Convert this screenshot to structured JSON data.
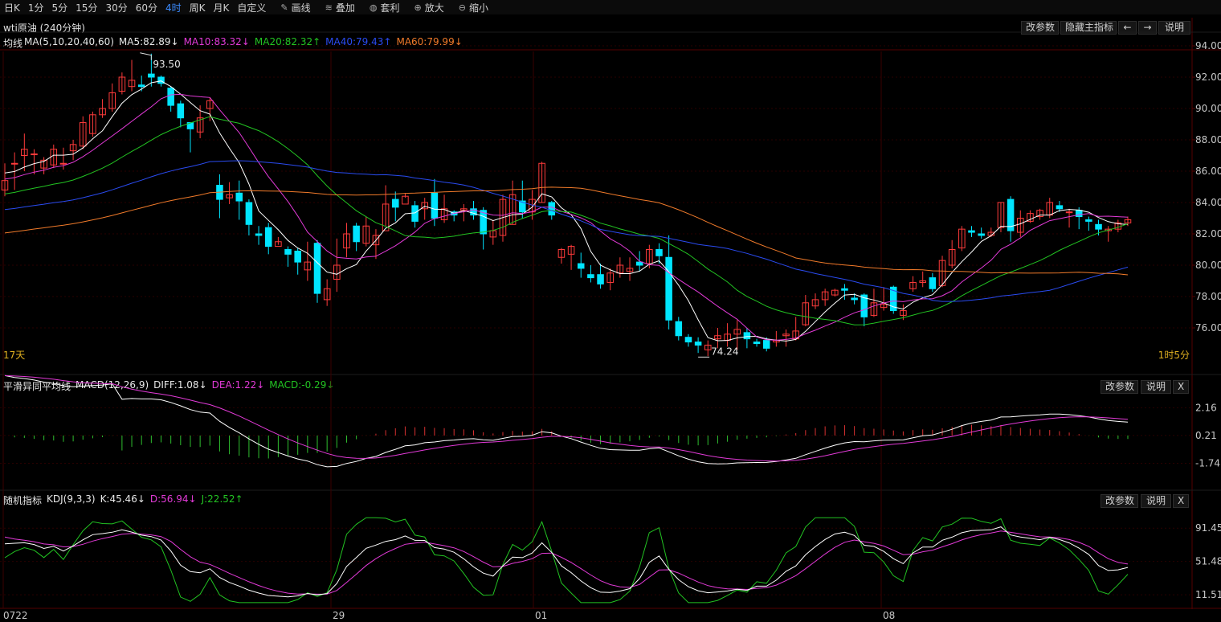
{
  "toolbar": {
    "periods": [
      "日K",
      "1分",
      "5分",
      "15分",
      "30分",
      "60分",
      "4时",
      "周K",
      "月K",
      "自定义"
    ],
    "active_index": 6,
    "tools": [
      {
        "label": "画线",
        "icon": "pencil-icon"
      },
      {
        "label": "叠加",
        "icon": "layers-icon"
      },
      {
        "label": "套利",
        "icon": "money-bag-icon"
      },
      {
        "label": "放大",
        "icon": "zoom-in-icon"
      },
      {
        "label": "缩小",
        "icon": "zoom-out-icon"
      }
    ]
  },
  "main_panel": {
    "title": "wti原油 (240分钟)",
    "buttons": {
      "params": "改参数",
      "hide": "隐藏主指标",
      "left": "←",
      "right": "→",
      "help": "说明"
    },
    "legend": {
      "name": "均线",
      "params": "MA(5,10,20,40,60)",
      "ma5": "MA5:82.89↓",
      "ma10": "MA10:83.32↓",
      "ma20": "MA20:82.32↑",
      "ma40": "MA40:79.43↑",
      "ma60": "MA60:79.99↓"
    },
    "corner_left": "17天",
    "corner_right": "1时5分",
    "high_label": "93.50",
    "low_label": "74.24",
    "y_ticks": [
      "94.00",
      "92.00",
      "90.00",
      "88.00",
      "86.00",
      "84.00",
      "82.00",
      "80.00",
      "78.00",
      "76.00"
    ]
  },
  "macd_panel": {
    "legend": {
      "name": "平滑异同平均线",
      "params": "MACD(12,26,9)",
      "diff": "DIFF:1.08↓",
      "dea": "DEA:1.22↓",
      "macd": "MACD:-0.29↓"
    },
    "buttons": {
      "params": "改参数",
      "help": "说明",
      "close": "X"
    },
    "y_ticks": [
      "2.16",
      "0.21",
      "-1.74"
    ]
  },
  "kdj_panel": {
    "legend": {
      "name": "随机指标",
      "params": "KDJ(9,3,3)",
      "k": "K:45.46↓",
      "d": "D:56.94↓",
      "j": "J:22.52↑"
    },
    "buttons": {
      "params": "改参数",
      "help": "说明",
      "close": "X"
    },
    "y_ticks": [
      "91.45",
      "51.48",
      "11.51"
    ]
  },
  "x_labels": [
    "0722",
    "29",
    "01",
    "08"
  ],
  "colors": {
    "up": "#ff3b3b",
    "down": "#00e5ff",
    "ma5": "#ffffff",
    "ma10": "#e23ad7",
    "ma20": "#22c322",
    "ma40": "#2a4bf0",
    "ma60": "#f07a2a",
    "grid": "#2a0000"
  },
  "chart_data": [
    {
      "type": "candlestick",
      "ylim": [
        74,
        94
      ],
      "candles": [
        [
          84.8,
          85.4,
          84.4,
          86.5
        ],
        [
          86.5,
          86.5,
          84.8,
          87.2
        ],
        [
          87.0,
          87.4,
          86.0,
          88.4
        ],
        [
          87.1,
          87.1,
          85.8,
          87.4
        ],
        [
          86.2,
          86.7,
          85.8,
          86.9
        ],
        [
          86.4,
          87.4,
          86.2,
          87.7
        ],
        [
          86.5,
          86.5,
          86.1,
          87.5
        ],
        [
          87.3,
          87.7,
          86.7,
          88.0
        ],
        [
          87.6,
          89.1,
          87.4,
          89.5
        ],
        [
          88.4,
          89.6,
          88.2,
          89.8
        ],
        [
          89.6,
          90.0,
          89.4,
          90.6
        ],
        [
          90.0,
          91.0,
          89.8,
          91.6
        ],
        [
          91.1,
          92.0,
          90.9,
          92.3
        ],
        [
          91.4,
          91.8,
          91.1,
          93.1
        ],
        [
          91.5,
          91.4,
          91.1,
          92.1
        ],
        [
          92.2,
          92.0,
          91.4,
          93.5
        ],
        [
          92.0,
          91.6,
          91.4,
          92.1
        ],
        [
          91.3,
          90.2,
          89.8,
          91.4
        ],
        [
          90.3,
          89.4,
          88.8,
          90.5
        ],
        [
          89.1,
          88.7,
          87.2,
          89.1
        ],
        [
          88.5,
          89.4,
          88.1,
          90.2
        ],
        [
          90.0,
          90.5,
          89.2,
          90.7
        ],
        [
          85.1,
          84.2,
          83.0,
          85.8
        ],
        [
          84.3,
          84.5,
          83.9,
          85.3
        ],
        [
          84.6,
          84.1,
          82.9,
          85.4
        ],
        [
          84.0,
          82.6,
          81.9,
          84.2
        ],
        [
          82.0,
          81.9,
          81.3,
          82.5
        ],
        [
          82.4,
          81.2,
          80.7,
          82.7
        ],
        [
          81.2,
          81.5,
          81.3,
          81.8
        ],
        [
          81.0,
          80.7,
          79.9,
          81.2
        ],
        [
          80.9,
          80.2,
          79.4,
          81.1
        ],
        [
          79.7,
          80.2,
          79.0,
          81.5
        ],
        [
          81.4,
          78.2,
          77.6,
          81.6
        ],
        [
          77.8,
          78.5,
          77.4,
          79.1
        ],
        [
          79.1,
          80.0,
          78.3,
          81.7
        ],
        [
          81.1,
          82.0,
          80.5,
          82.7
        ],
        [
          82.5,
          81.5,
          80.9,
          82.7
        ],
        [
          81.4,
          82.5,
          81.2,
          83.1
        ],
        [
          81.3,
          81.9,
          80.4,
          82.3
        ],
        [
          82.2,
          83.9,
          82.5,
          85.1
        ],
        [
          84.2,
          83.7,
          82.8,
          84.7
        ],
        [
          83.9,
          84.4,
          84.3,
          84.6
        ],
        [
          83.8,
          82.8,
          82.4,
          84.1
        ],
        [
          83.6,
          84.0,
          82.9,
          84.3
        ],
        [
          84.6,
          83.0,
          82.5,
          85.5
        ],
        [
          82.9,
          83.6,
          82.7,
          84.5
        ],
        [
          83.4,
          83.2,
          82.8,
          83.5
        ],
        [
          83.5,
          83.6,
          82.8,
          83.9
        ],
        [
          83.6,
          83.2,
          82.9,
          84.1
        ],
        [
          83.5,
          82.0,
          81.0,
          83.7
        ],
        [
          81.8,
          82.2,
          81.3,
          82.9
        ],
        [
          81.9,
          84.2,
          81.5,
          84.5
        ],
        [
          82.6,
          84.5,
          82.6,
          85.4
        ],
        [
          84.1,
          83.4,
          83.0,
          85.4
        ],
        [
          83.4,
          84.2,
          82.9,
          84.8
        ],
        [
          84.0,
          86.5,
          84.0,
          86.6
        ],
        [
          84.0,
          83.2,
          82.9,
          84.1
        ],
        [
          80.5,
          81.0,
          80.1,
          81.1
        ],
        [
          80.7,
          81.2,
          79.7,
          81.3
        ],
        [
          80.1,
          79.8,
          79.2,
          80.8
        ],
        [
          79.4,
          79.2,
          78.9,
          80.0
        ],
        [
          79.4,
          78.8,
          78.5,
          80.1
        ],
        [
          78.9,
          79.5,
          78.4,
          79.8
        ],
        [
          79.5,
          80.0,
          79.2,
          80.5
        ],
        [
          79.6,
          79.8,
          79.0,
          80.5
        ],
        [
          80.2,
          80.0,
          79.6,
          80.9
        ],
        [
          80.1,
          81.0,
          79.8,
          81.3
        ],
        [
          81.0,
          80.6,
          80.1,
          81.4
        ],
        [
          80.5,
          76.5,
          75.9,
          81.9
        ],
        [
          76.4,
          75.5,
          75.2,
          76.7
        ],
        [
          75.4,
          75.1,
          74.8,
          75.6
        ],
        [
          75.1,
          74.9,
          74.4,
          75.4
        ],
        [
          74.6,
          74.9,
          74.2,
          75.2
        ],
        [
          75.3,
          75.5,
          74.7,
          76.0
        ],
        [
          75.2,
          75.6,
          74.8,
          76.3
        ],
        [
          75.6,
          75.9,
          74.6,
          76.5
        ],
        [
          75.7,
          75.3,
          74.7,
          76.0
        ],
        [
          75.1,
          75.0,
          74.8,
          75.3
        ],
        [
          75.2,
          74.7,
          74.5,
          75.4
        ],
        [
          75.1,
          75.2,
          74.8,
          75.8
        ],
        [
          75.5,
          75.6,
          74.8,
          75.9
        ],
        [
          75.3,
          75.8,
          75.2,
          76.7
        ],
        [
          76.2,
          77.6,
          76.1,
          78.1
        ],
        [
          77.4,
          77.8,
          77.2,
          78.2
        ],
        [
          77.8,
          78.3,
          77.4,
          78.5
        ],
        [
          78.1,
          78.4,
          78.0,
          78.5
        ],
        [
          78.5,
          78.4,
          77.8,
          78.8
        ],
        [
          77.9,
          77.8,
          77.5,
          78.2
        ],
        [
          78.1,
          76.7,
          76.1,
          78.2
        ],
        [
          76.8,
          77.6,
          76.7,
          78.5
        ],
        [
          77.3,
          77.5,
          77.1,
          78.6
        ],
        [
          78.6,
          77.1,
          76.9,
          78.7
        ],
        [
          76.8,
          77.1,
          76.5,
          77.5
        ],
        [
          78.5,
          78.9,
          78.3,
          79.3
        ],
        [
          78.9,
          79.0,
          78.6,
          79.6
        ],
        [
          79.2,
          78.5,
          78.3,
          79.5
        ],
        [
          78.7,
          80.3,
          78.6,
          80.6
        ],
        [
          80.0,
          81.0,
          79.8,
          81.6
        ],
        [
          81.1,
          82.3,
          80.9,
          82.5
        ],
        [
          82.2,
          82.1,
          81.8,
          82.5
        ],
        [
          82.0,
          81.9,
          81.7,
          82.4
        ],
        [
          81.9,
          82.1,
          81.8,
          82.4
        ],
        [
          82.4,
          84.0,
          82.1,
          84.0
        ],
        [
          84.2,
          82.2,
          81.5,
          84.4
        ],
        [
          82.1,
          83.0,
          81.8,
          83.5
        ],
        [
          82.8,
          83.3,
          82.7,
          83.5
        ],
        [
          83.1,
          83.5,
          82.9,
          83.6
        ],
        [
          83.2,
          84.0,
          83.0,
          84.3
        ],
        [
          83.8,
          83.6,
          83.4,
          84.1
        ],
        [
          83.4,
          83.4,
          82.4,
          83.6
        ],
        [
          83.5,
          83.1,
          82.3,
          83.7
        ],
        [
          82.9,
          82.8,
          82.2,
          83.1
        ],
        [
          82.6,
          82.3,
          81.9,
          82.9
        ],
        [
          82.2,
          82.3,
          81.5,
          82.5
        ],
        [
          82.3,
          82.7,
          82.1,
          82.9
        ],
        [
          82.7,
          82.9,
          82.5,
          83.1
        ]
      ],
      "high": 93.5,
      "low": 74.24
    },
    {
      "type": "bar",
      "series": [
        {
          "name": "DIFF"
        },
        {
          "name": "DEA"
        },
        {
          "name": "MACD"
        }
      ],
      "ylim": [
        -2.5,
        2.8
      ]
    },
    {
      "type": "line",
      "series": [
        {
          "name": "K"
        },
        {
          "name": "D"
        },
        {
          "name": "J"
        }
      ],
      "ylim": [
        0,
        110
      ]
    }
  ]
}
